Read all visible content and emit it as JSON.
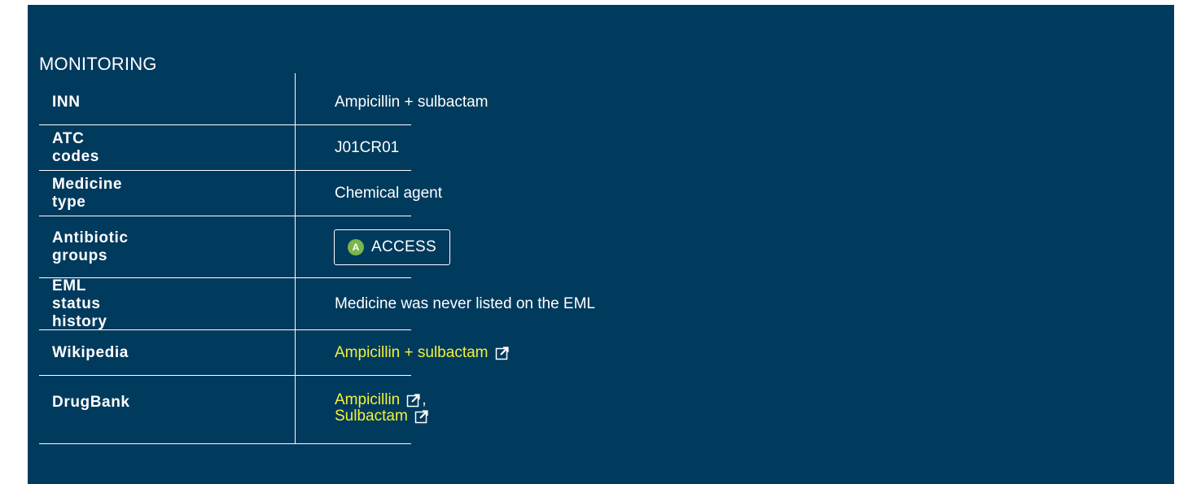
{
  "section": {
    "title": "MONITORING"
  },
  "colors": {
    "panel_background": "#003a5d",
    "link": "#f2f23a",
    "access_badge": "#7ab648",
    "text": "#ffffff"
  },
  "rows": [
    {
      "key": "INN",
      "value": "Ampicillin + sulbactam"
    },
    {
      "key": "ATC codes",
      "value": "J01CR01"
    },
    {
      "key": "Medicine type",
      "value": "Chemical agent"
    },
    {
      "key": "Antibiotic groups",
      "badge": {
        "letter": "A",
        "label": "ACCESS"
      }
    },
    {
      "key": "EML status history",
      "value": "Medicine was never listed on the EML"
    },
    {
      "key": "Wikipedia",
      "links": [
        {
          "text": "Ampicillin + sulbactam",
          "icon": "external-link-icon"
        }
      ]
    },
    {
      "key": "DrugBank",
      "links": [
        {
          "text": "Ampicillin",
          "icon": "external-link-icon",
          "separator": ","
        },
        {
          "text": "Sulbactam",
          "icon": "external-link-icon"
        }
      ]
    }
  ]
}
